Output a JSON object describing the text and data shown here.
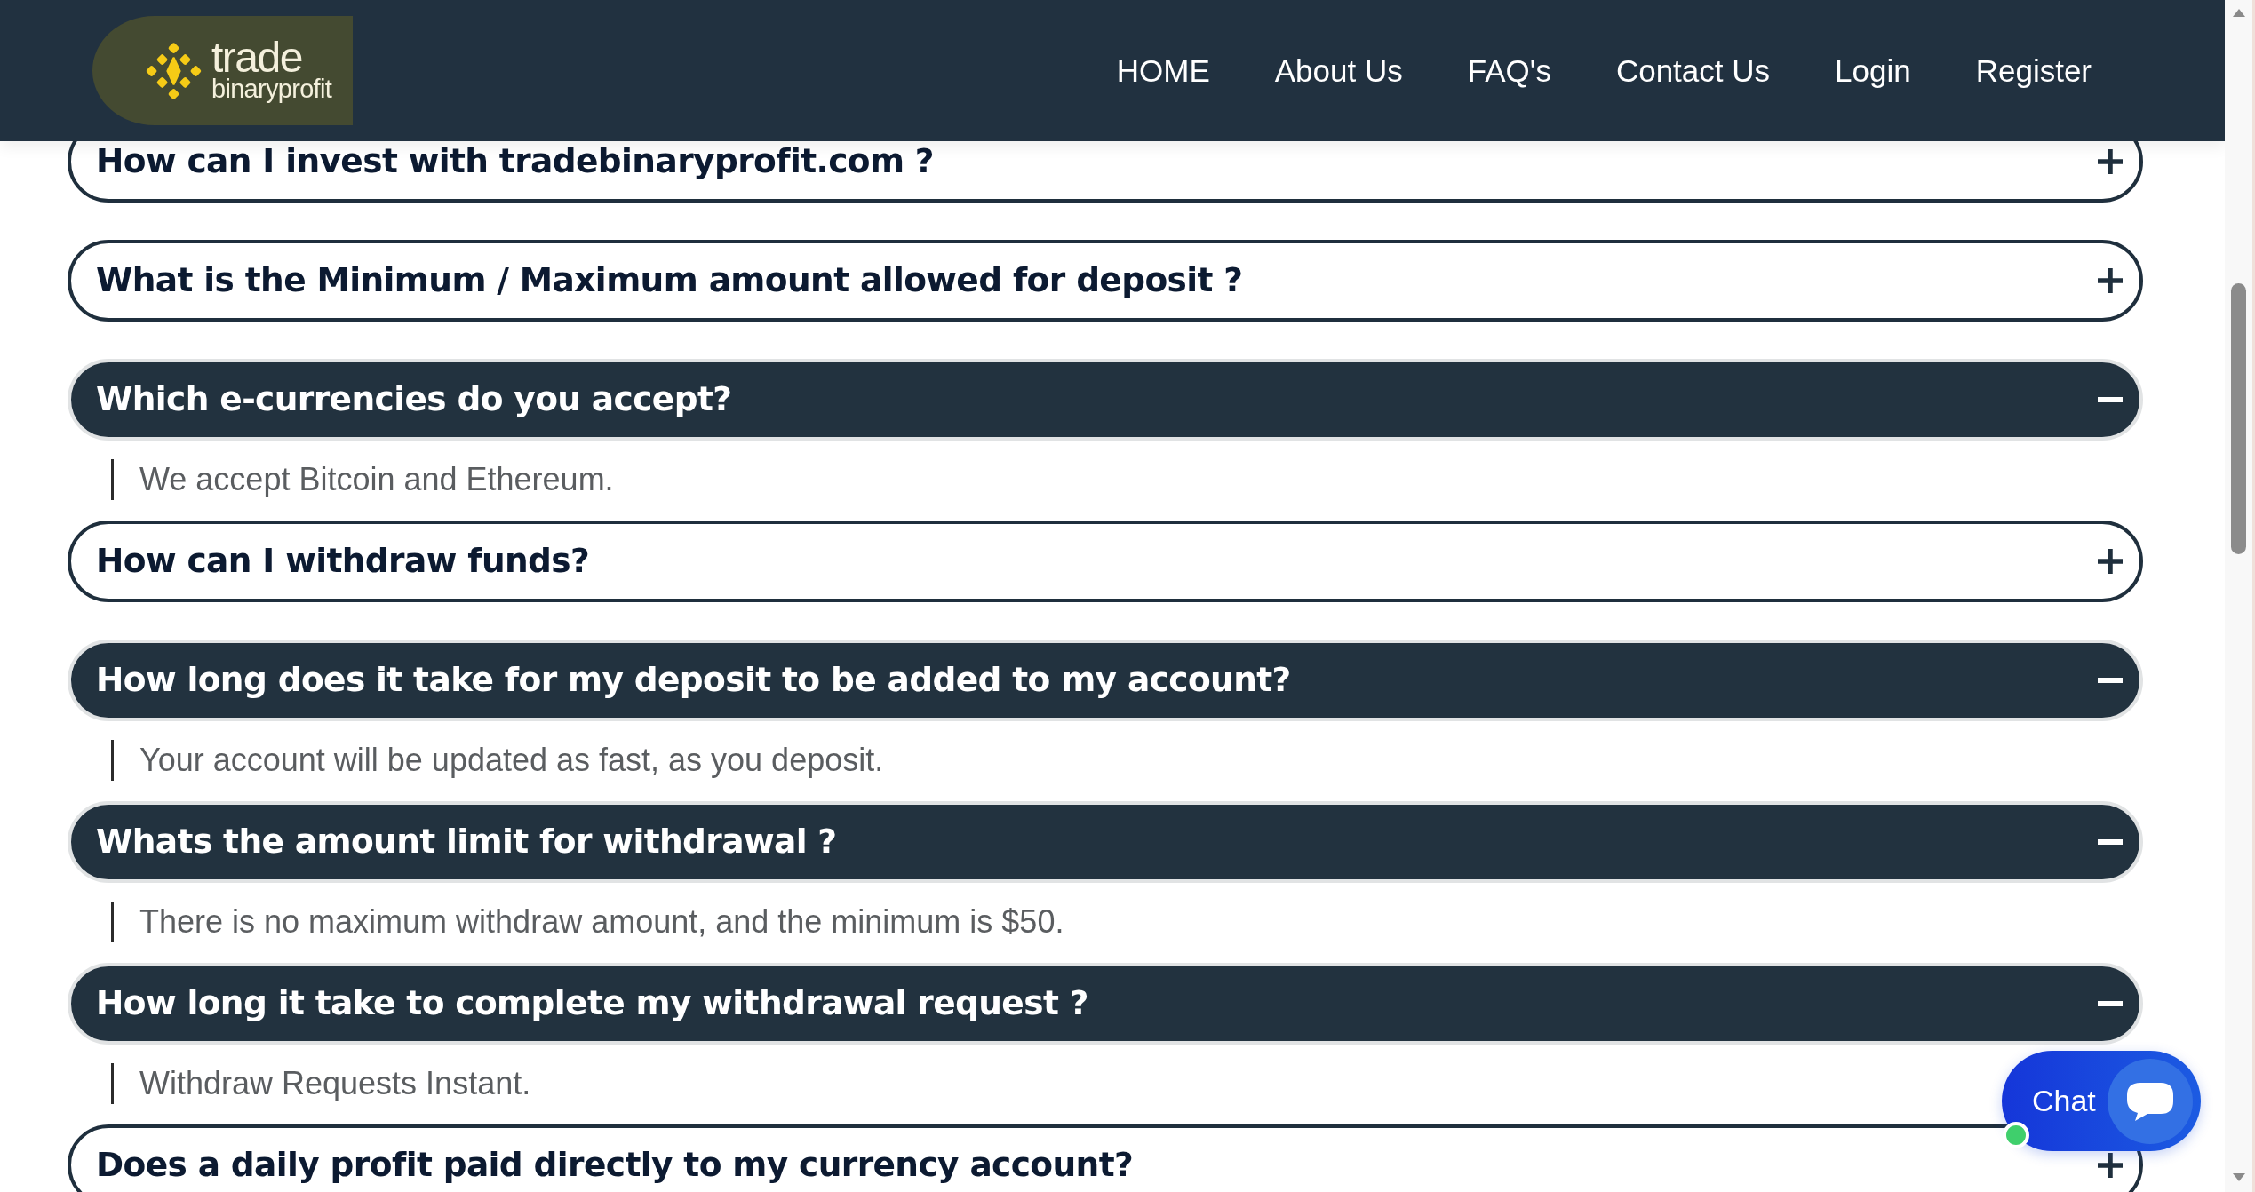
{
  "header": {
    "logo": {
      "top_line": "trade",
      "bottom_line": "binaryprofit"
    },
    "nav": [
      "HOME",
      "About Us",
      "FAQ's",
      "Contact Us",
      "Login",
      "Register"
    ]
  },
  "faq": [
    {
      "question": "How can I invest with tradebinaryprofit.com ?",
      "expanded": false
    },
    {
      "question": "What is the Minimum / Maximum amount allowed for deposit ?",
      "expanded": false
    },
    {
      "question": "Which e-currencies do you accept?",
      "expanded": true,
      "answer": "We accept Bitcoin and Ethereum."
    },
    {
      "question": "How can I withdraw funds?",
      "expanded": false
    },
    {
      "question": "How long does it take for my deposit to be added to my account?",
      "expanded": true,
      "answer": "Your account will be updated as fast, as you deposit."
    },
    {
      "question": "Whats the amount limit for withdrawal ?",
      "expanded": true,
      "answer": "There is no maximum withdraw amount, and the minimum is $50."
    },
    {
      "question": "How long it take to complete my withdrawal request ?",
      "expanded": true,
      "answer": "Withdraw Requests Instant."
    },
    {
      "question": "Does a daily profit paid directly to my currency account?",
      "expanded": false
    }
  ],
  "chat": {
    "label": "Chat",
    "online": true
  }
}
